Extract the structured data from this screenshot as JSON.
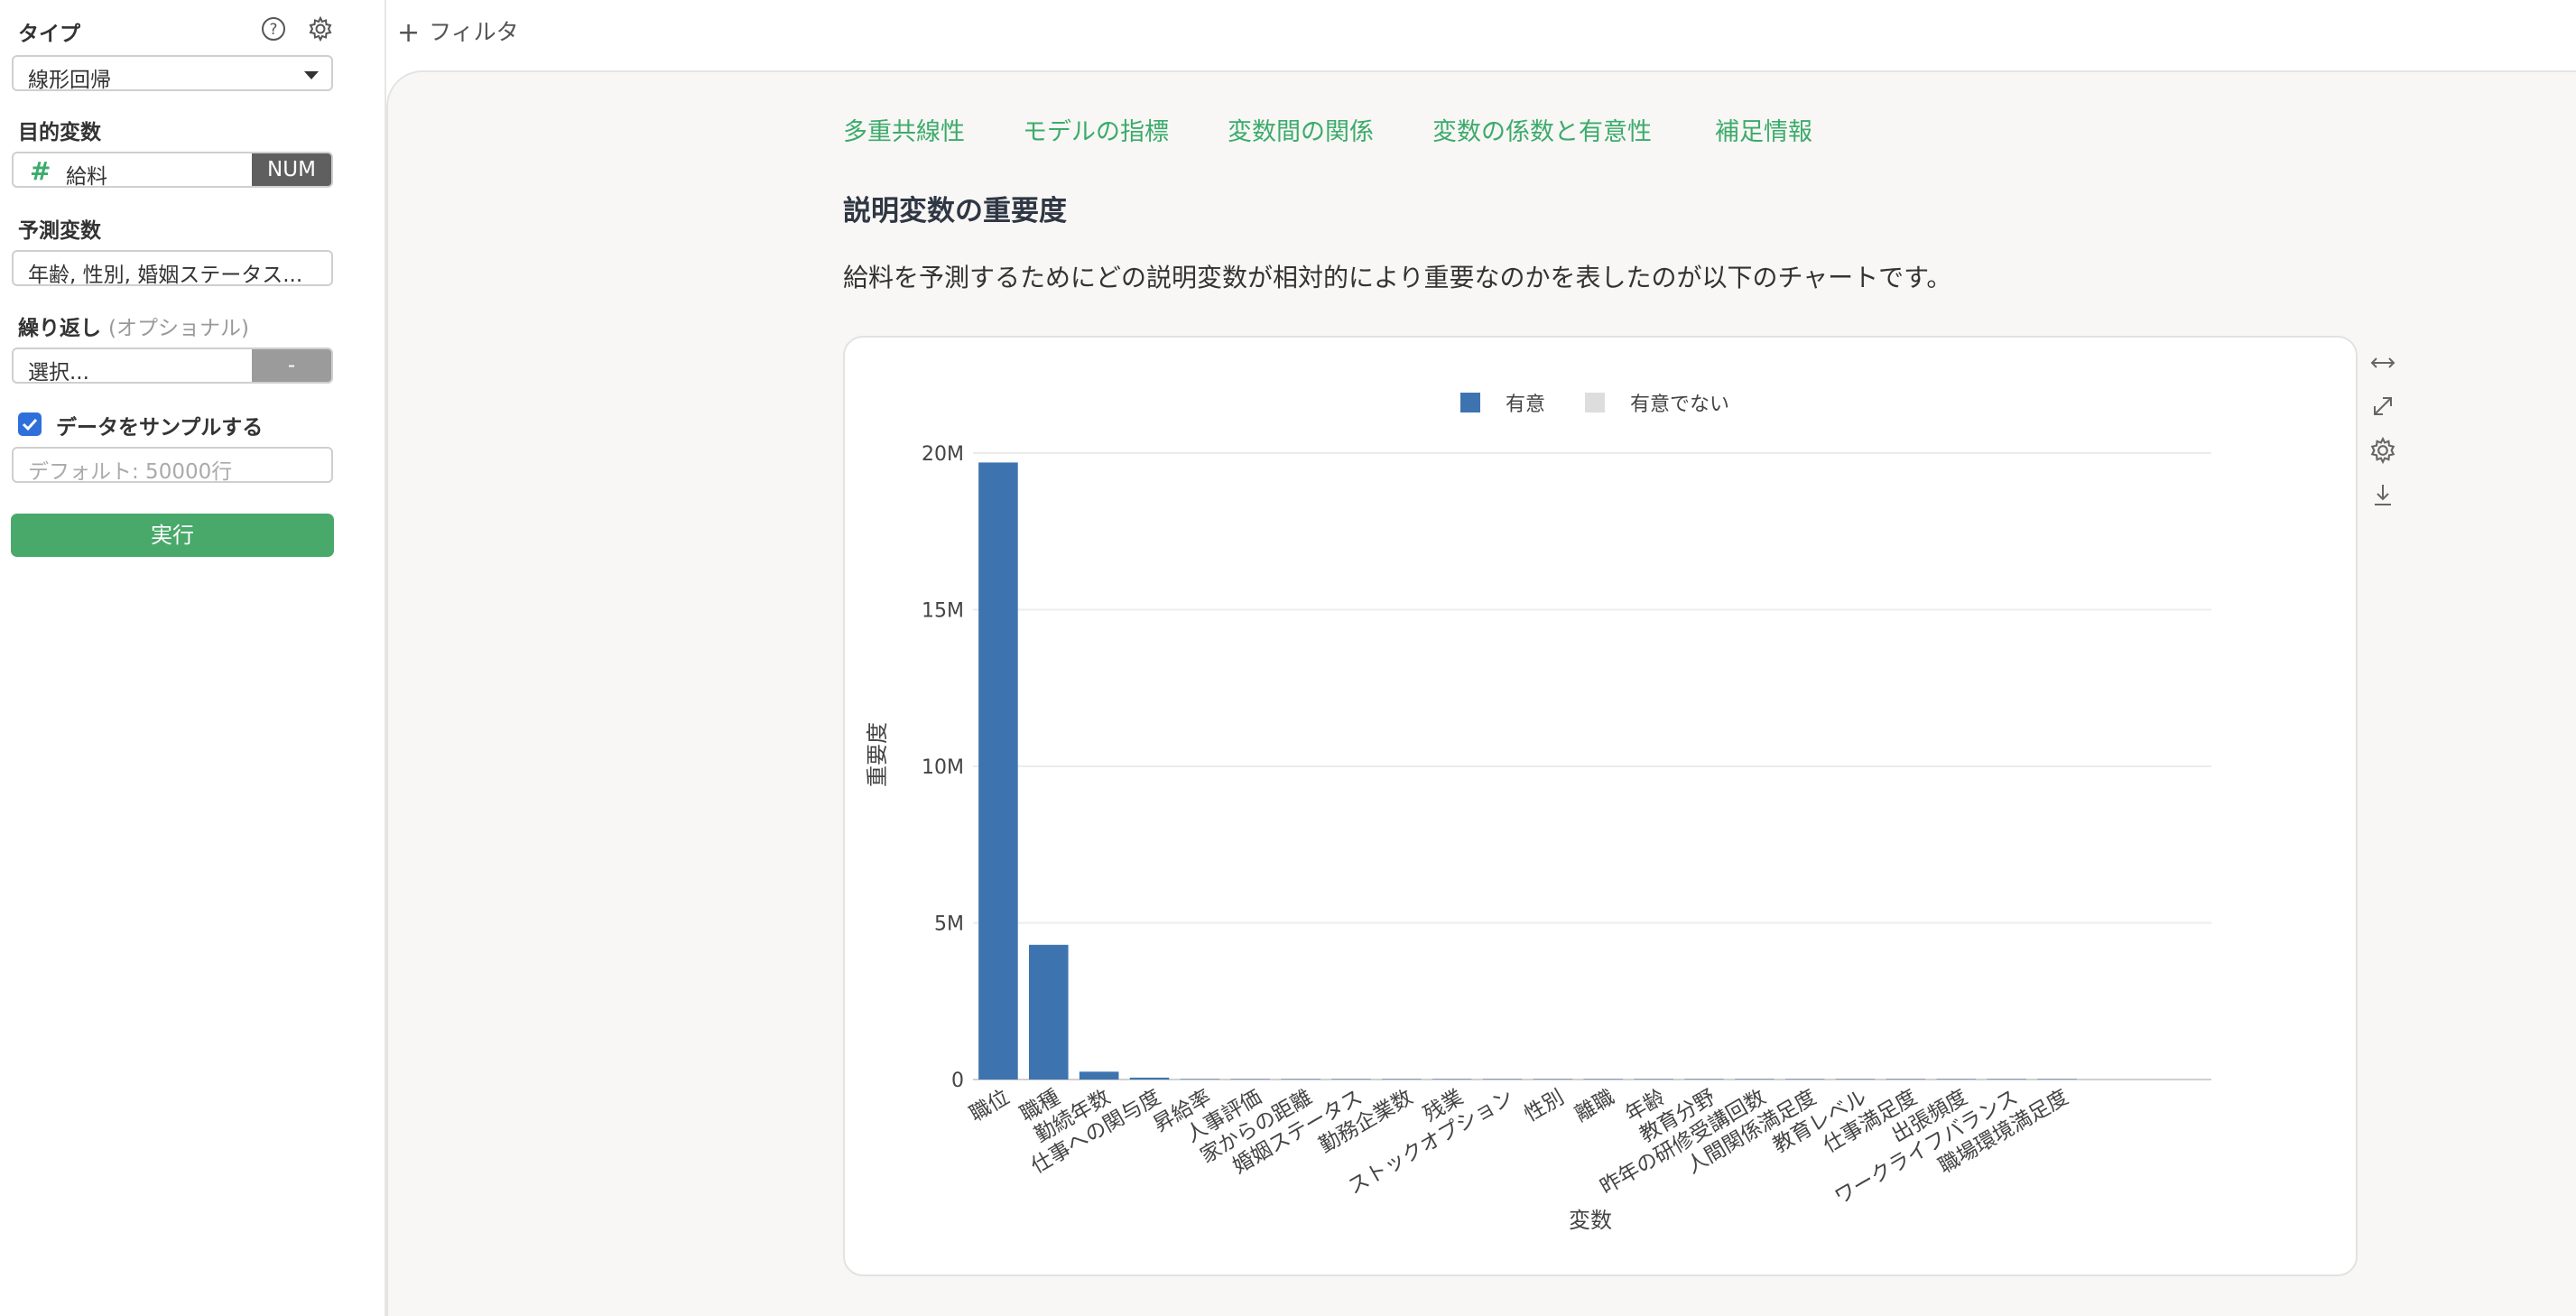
{
  "sidebar": {
    "type_label": "タイプ",
    "type_value": "線形回帰",
    "target_label": "目的変数",
    "target_value": "給料",
    "target_type": "NUM",
    "predictor_label": "予測変数",
    "predictor_value": "年齢, 性別, 婚姻ステータス...",
    "repeat_label": "繰り返し",
    "repeat_optional": "(オプショナル)",
    "repeat_placeholder": "選択...",
    "repeat_button": "-",
    "sample_label": "データをサンプルする",
    "sample_placeholder": "デフォルト: 50000行",
    "run_label": "実行"
  },
  "topbar": {
    "filter_label": "フィルタ"
  },
  "tabs": [
    "多重共線性",
    "モデルの指標",
    "変数間の関係",
    "変数の係数と有意性",
    "補足情報"
  ],
  "section": {
    "title": "説明変数の重要度",
    "description": "給料を予測するためにどの説明変数が相対的により重要なのかを表したのが以下のチャートです。"
  },
  "colors": {
    "accent": "#3cab6b",
    "bar_significant": "#3d74b0",
    "bar_not_significant": "#dddddd"
  },
  "chart_data": {
    "type": "bar",
    "xlabel": "変数",
    "ylabel": "重要度",
    "ylim": [
      0,
      20000000
    ],
    "yticks": [
      0,
      5000000,
      10000000,
      15000000,
      20000000
    ],
    "ytick_labels": [
      "0",
      "5M",
      "10M",
      "15M",
      "20M"
    ],
    "legend": [
      "有意",
      "有意でない"
    ],
    "legend_position": "top-center",
    "grid": true,
    "categories": [
      "職位",
      "職種",
      "勤続年数",
      "仕事への関与度",
      "昇給率",
      "人事評価",
      "家からの距離",
      "婚姻ステータス",
      "勤務企業数",
      "残業",
      "ストックオプション",
      "性別",
      "離職",
      "年齢",
      "教育分野",
      "昨年の研修受講回数",
      "人間関係満足度",
      "教育レベル",
      "仕事満足度",
      "出張頻度",
      "ワークライフバランス",
      "職場環境満足度"
    ],
    "values": [
      19700000,
      4300000,
      250000,
      60000,
      15000,
      12000,
      10000,
      8000,
      7000,
      6000,
      5000,
      4000,
      3500,
      3000,
      2500,
      2000,
      1800,
      1500,
      1200,
      1000,
      800,
      600
    ],
    "significant": [
      true,
      true,
      true,
      true,
      true,
      true,
      true,
      true,
      true,
      true,
      true,
      true,
      true,
      true,
      true,
      true,
      true,
      true,
      true,
      true,
      true,
      true
    ]
  }
}
